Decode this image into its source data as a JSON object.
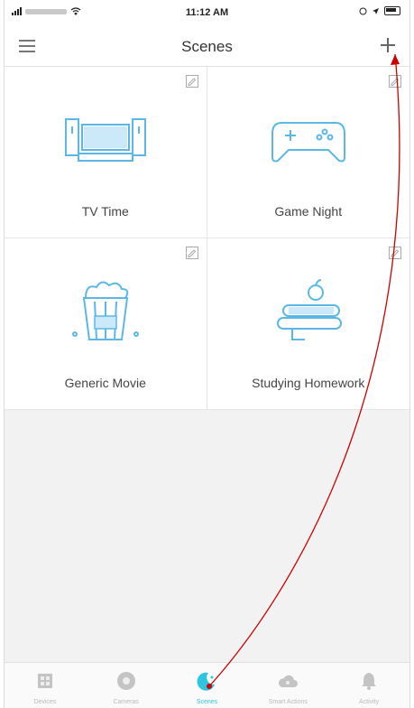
{
  "status_bar": {
    "time": "11:12 AM"
  },
  "header": {
    "title": "Scenes"
  },
  "scenes": [
    {
      "label": "TV Time",
      "icon": "tv-icon"
    },
    {
      "label": "Game Night",
      "icon": "gamepad-icon"
    },
    {
      "label": "Generic Movie",
      "icon": "popcorn-icon"
    },
    {
      "label": "Studying Homework",
      "icon": "books-apple-icon"
    }
  ],
  "tabs": [
    {
      "label": "Devices",
      "icon": "devices-icon"
    },
    {
      "label": "Cameras",
      "icon": "camera-icon"
    },
    {
      "label": "Scenes",
      "icon": "scenes-icon",
      "active": true
    },
    {
      "label": "Smart Actions",
      "icon": "cloud-icon"
    },
    {
      "label": "Activity",
      "icon": "bell-icon"
    }
  ],
  "colors": {
    "accent": "#2fc5e0",
    "icon_stroke": "#5bb8e6",
    "annotation": "#cc0000"
  }
}
